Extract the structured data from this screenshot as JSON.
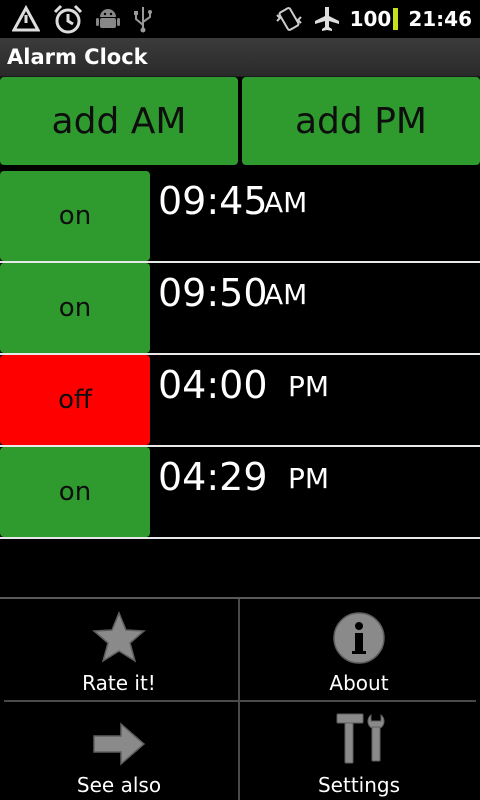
{
  "status_bar": {
    "icons": [
      "warning-triangle-icon",
      "alarm-clock-icon",
      "android-icon",
      "usb-icon",
      "vibrate-icon",
      "airplane-mode-icon"
    ],
    "battery": "100",
    "time": "21:46"
  },
  "app": {
    "title": "Alarm Clock"
  },
  "buttons": {
    "add_am": "add AM",
    "add_pm": "add PM"
  },
  "alarms": [
    {
      "toggle": "on",
      "time": "09:45",
      "period": "AM"
    },
    {
      "toggle": "on",
      "time": "09:50",
      "period": "AM"
    },
    {
      "toggle": "off",
      "time": "04:00",
      "period": "PM"
    },
    {
      "toggle": "on",
      "time": "04:29",
      "period": "PM"
    }
  ],
  "menu": {
    "rate": "Rate it!",
    "about": "About",
    "see_also": "See also",
    "settings": "Settings"
  },
  "colors": {
    "on": "#2f9b2f",
    "off": "#ff0000",
    "battery": "#c7e01a"
  }
}
